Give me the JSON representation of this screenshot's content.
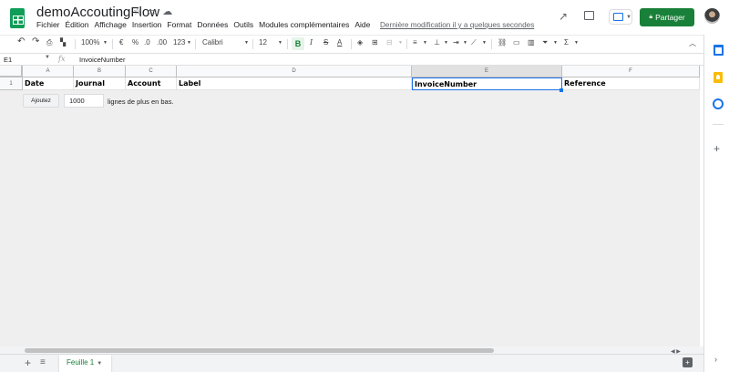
{
  "document": {
    "title": "demoAccoutingFlow",
    "last_edit": "Dernière modification il y a quelques secondes",
    "share_label": "Partager"
  },
  "menu": [
    "Fichier",
    "Édition",
    "Affichage",
    "Insertion",
    "Format",
    "Données",
    "Outils",
    "Modules complémentaires",
    "Aide"
  ],
  "toolbar": {
    "zoom": "100%",
    "currency": "€",
    "percent": "%",
    "dec_decrease": ".0",
    ".00": ".00",
    "more_formats": "123",
    "font": "Calibri",
    "font_size": "12",
    "bold": "B",
    "italic": "I",
    "strike": "S",
    "text_color": "A"
  },
  "formula_bar": {
    "name_box": "E1",
    "fx": "fx",
    "content": "InvoiceNumber"
  },
  "columns": [
    "A",
    "B",
    "C",
    "D",
    "E",
    "F"
  ],
  "rows": [
    "1"
  ],
  "row1": [
    "Date",
    "Journal",
    "Account",
    "Label",
    "InvoiceNumber",
    "Reference"
  ],
  "add_rows": {
    "button": "Ajoutez",
    "value": "1000",
    "suffix": "lignes de plus en bas."
  },
  "sheets": {
    "active": "Feuille 1",
    "add": "+",
    "all": "≡"
  },
  "colors": {
    "brand_green": "#188038",
    "selection_blue": "#1a73e8",
    "grid_bg": "#efefef"
  }
}
